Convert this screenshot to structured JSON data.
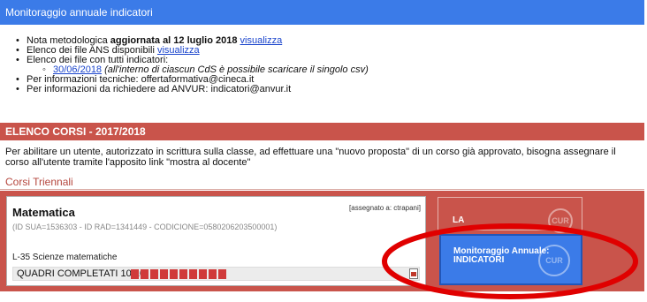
{
  "header": {
    "title": "Monitoraggio annuale indicatori"
  },
  "info": {
    "nota_prefix": "Nota metodologica ",
    "nota_bold": "aggiornata al 12 luglio 2018",
    "nota_link": "visualizza",
    "ans_text": "Elenco dei file ANS disponibili",
    "ans_link": "visualizza",
    "tutti_text": "Elenco dei file con tutti indicatori:",
    "date_link": "30/06/2018",
    "date_note": "(all'interno di ciascun CdS è possibile scaricare il singolo csv)",
    "tecniche": "Per informazioni tecniche: offertaformativa@cineca.it",
    "anvur": "Per informazioni da richiedere ad ANVUR: indicatori@anvur.it"
  },
  "section": {
    "title": "ELENCO CORSI - 2017/2018",
    "description": "Per abilitare un utente, autorizzato in scrittura sulla classe, ad effettuare una \"nuovo proposta\" di un corso già approvato, bisogna assegnare il corso all'utente tramite l'apposito link \"mostra al docente\"",
    "subtitle": "Corsi Triennali"
  },
  "course": {
    "name": "Matematica",
    "assigned": "[assegnato a: ctrapani]",
    "codes_line": "(ID SUA=1536303 - ID RAD=1341449 - CODICIONE=0580206203500001)",
    "classe": "L-35 Scienze matematiche",
    "quadri_label": "QUADRI COMPLETATI 10/10",
    "progress_completed": 10,
    "progress_total": 10
  },
  "buttons": {
    "la_label": "LA",
    "monitor_label_1": "Monitoraggio Annuale:",
    "monitor_label_2": "INDICATORI",
    "emblem_text": "CUR"
  },
  "colors": {
    "header_blue": "#3b7be8",
    "section_red": "#c9544b",
    "progress_red": "#d03a3a",
    "annotation_red": "#e00000"
  },
  "icons": {
    "pdf": "pdf-icon"
  }
}
